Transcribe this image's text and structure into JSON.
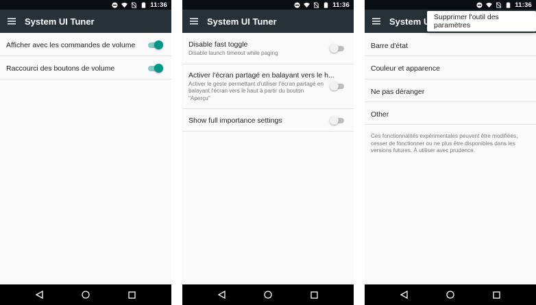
{
  "status": {
    "time": "11:36"
  },
  "app": {
    "title": "System UI Tuner"
  },
  "screen1": {
    "rows": [
      {
        "label": "Afficher avec les commandes de volume",
        "toggle": "on"
      },
      {
        "label": "Raccourci des boutons de volume",
        "toggle": "on"
      }
    ]
  },
  "screen2": {
    "rows": [
      {
        "label": "Disable fast toggle",
        "sub": "Disable launch timeout while paging",
        "toggle": "off"
      },
      {
        "label": "Activer l'écran partagé en balayant vers le h...",
        "sub": "Activer le geste permettant d'utiliser l'écran partagé en balayant l'écran vers le haut à partir du bouton \"Aperçu\"",
        "toggle": "off"
      },
      {
        "label": "Show full importance settings",
        "toggle": "off"
      }
    ]
  },
  "screen3": {
    "menu_popup": "Supprimer l'outil des paramètres",
    "items": [
      {
        "label": "Barre d'état"
      },
      {
        "label": "Couleur et apparence"
      },
      {
        "label": "Ne pas déranger"
      },
      {
        "label": "Other"
      }
    ],
    "note": "Ces fonctionnalités expérimentales peuvent être modifiées, cesser de fonctionner ou ne plus être disponibles dans les versions futures. À utiliser avec prudence."
  },
  "colors": {
    "toolbar": "#263238",
    "accent": "#009688",
    "status_bar": "#0b0f12"
  },
  "icons": [
    "dnd-icon",
    "wifi-icon",
    "no-sim-icon",
    "battery-icon",
    "hamburger-menu-icon",
    "back-icon",
    "home-icon",
    "recents-icon"
  ]
}
